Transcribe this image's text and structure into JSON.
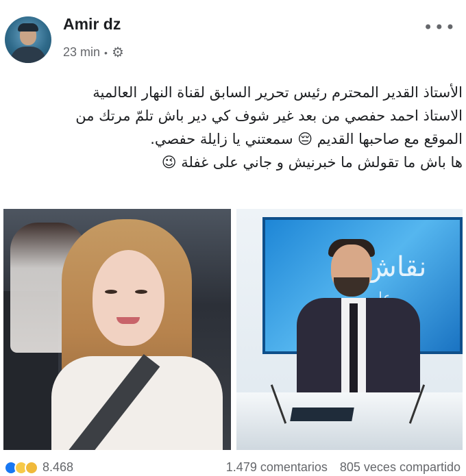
{
  "post": {
    "author": "Amir dz",
    "time": "23 min",
    "separator": "•",
    "privacy_icon": "gear-icon",
    "more_label": "•••",
    "lines": [
      "الأستاذ القدير المحترم رئيس تحرير السابق لقناة النهار العالمية",
      "الاستاذ احمد حفصي من بعد غير شوف كي دير باش تلمّ مرتك من",
      "الموقع مع صاحبها القديم 😔 سمعتني يا زايلة حفصي.",
      "ها باش ما تقولش ما خبرنيش و جاني على غفلة 😉"
    ],
    "photo_left_desc": "woman-in-car-photo",
    "photo_right_screen_line1": "نقاش",
    "photo_right_screen_line2": "على"
  },
  "footer": {
    "reaction_count": "8.468",
    "comments": "1.479 comentarios",
    "shares": "805 veces compartido"
  }
}
